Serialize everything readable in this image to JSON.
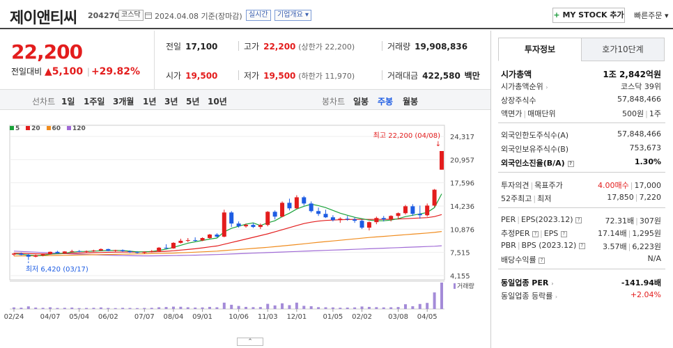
{
  "header": {
    "company": "제이앤티씨",
    "code": "204270",
    "market": "코스닥",
    "date": "2024.04.08",
    "basis": "기준(장마감)",
    "realtime": "실시간",
    "overview": "기업개요",
    "mystock": "MY STOCK 추가",
    "quick_order": "빠른주문"
  },
  "price": {
    "current": "22,200",
    "vs_label": "전일대비",
    "change": "5,100",
    "change_pct": "+29.82%"
  },
  "stats": {
    "prev_label": "전일",
    "prev": "17,100",
    "high_label": "고가",
    "high": "22,200",
    "upper_limit": "(상한가 22,200)",
    "volume_label": "거래량",
    "volume": "19,908,836",
    "open_label": "시가",
    "open": "19,500",
    "low_label": "저가",
    "low": "19,500",
    "lower_limit": "(하한가 11,970)",
    "amount_label": "거래대금",
    "amount": "422,580",
    "amount_unit": "백만"
  },
  "periods": {
    "line_label": "선차트",
    "line": [
      "1일",
      "1주일",
      "3개월",
      "1년",
      "3년",
      "5년",
      "10년"
    ],
    "candle_label": "봉차트",
    "candle": [
      "일봉",
      "주봉",
      "월봉"
    ]
  },
  "legend": [
    "5",
    "20",
    "60",
    "120"
  ],
  "colors": {
    "ma5": "#1aa23a",
    "ma20": "#e31d1d",
    "ma60": "#f08c1e",
    "ma120": "#a06bd6",
    "up": "#e31d1d",
    "down": "#1d5ce3",
    "volume": "#a48bd8"
  },
  "annotations": {
    "high": "최고 22,200 (04/08)",
    "low": "최저 6,420 (03/17)",
    "volume_label": "거래량"
  },
  "chart_data": {
    "type": "candlestick",
    "y_ticks": [
      "24,317",
      "20,957",
      "17,596",
      "14,236",
      "10,876",
      "7,515",
      "4,155"
    ],
    "x_ticks": [
      "02/24",
      "04/07",
      "05/04",
      "06/02",
      "07/07",
      "08/04",
      "09/01",
      "10/06",
      "11/03",
      "12/01",
      "01/05",
      "02/02",
      "03/08",
      "04/05"
    ],
    "ylim": [
      4155,
      24317
    ],
    "candles": [
      [
        7200,
        7450,
        7000,
        7350
      ],
      [
        7350,
        7500,
        7100,
        7150
      ],
      [
        7150,
        7300,
        6420,
        6900
      ],
      [
        6900,
        7200,
        6800,
        7100
      ],
      [
        7100,
        7350,
        6950,
        7250
      ],
      [
        7250,
        7650,
        7200,
        7600
      ],
      [
        7600,
        7750,
        7350,
        7400
      ],
      [
        7400,
        7700,
        7300,
        7650
      ],
      [
        7650,
        7900,
        7500,
        7700
      ],
      [
        7700,
        7850,
        7550,
        7600
      ],
      [
        7600,
        7800,
        7450,
        7700
      ],
      [
        7700,
        7900,
        7600,
        7800
      ],
      [
        7800,
        8100,
        7700,
        8000
      ],
      [
        8000,
        8050,
        7700,
        7750
      ],
      [
        7750,
        7900,
        7600,
        7850
      ],
      [
        7850,
        7950,
        7600,
        7700
      ],
      [
        7700,
        7800,
        7450,
        7550
      ],
      [
        7550,
        7700,
        7350,
        7450
      ],
      [
        7450,
        7650,
        7300,
        7600
      ],
      [
        7600,
        7850,
        7500,
        7700
      ],
      [
        7700,
        8300,
        7600,
        8200
      ],
      [
        8200,
        8700,
        8000,
        8100
      ],
      [
        8100,
        9000,
        8050,
        8900
      ],
      [
        8900,
        9500,
        8800,
        9200
      ],
      [
        9200,
        9600,
        9000,
        9300
      ],
      [
        9300,
        9700,
        9100,
        9250
      ],
      [
        9250,
        9700,
        9150,
        9600
      ],
      [
        9600,
        10200,
        9500,
        10100
      ],
      [
        10100,
        10300,
        9700,
        9800
      ],
      [
        9800,
        13700,
        9700,
        13300
      ],
      [
        13300,
        13500,
        11200,
        11700
      ],
      [
        11700,
        12000,
        11100,
        11300
      ],
      [
        11300,
        11700,
        11100,
        11500
      ],
      [
        11500,
        11800,
        11050,
        11200
      ],
      [
        11200,
        11700,
        10900,
        11500
      ],
      [
        11500,
        13500,
        11300,
        13400
      ],
      [
        13400,
        13600,
        12300,
        12700
      ],
      [
        12700,
        14900,
        12600,
        14700
      ],
      [
        14700,
        15300,
        13600,
        13900
      ],
      [
        13900,
        15800,
        13800,
        15500
      ],
      [
        15500,
        15700,
        14300,
        14600
      ],
      [
        14600,
        14900,
        13300,
        13500
      ],
      [
        13500,
        14000,
        12800,
        13100
      ],
      [
        13100,
        13700,
        12500,
        12600
      ],
      [
        12600,
        12900,
        12000,
        12200
      ],
      [
        12200,
        12600,
        11800,
        12400
      ],
      [
        12400,
        12800,
        12100,
        12300
      ],
      [
        12300,
        12600,
        11800,
        12100
      ],
      [
        12100,
        12300,
        10900,
        11100
      ],
      [
        11100,
        12000,
        10700,
        11900
      ],
      [
        11900,
        12700,
        11600,
        12500
      ],
      [
        12500,
        12800,
        12000,
        12300
      ],
      [
        12300,
        12900,
        12000,
        12800
      ],
      [
        12800,
        13300,
        12300,
        13200
      ],
      [
        13200,
        14400,
        13000,
        14200
      ],
      [
        14200,
        14500,
        12800,
        13100
      ],
      [
        13100,
        14300,
        12400,
        12900
      ],
      [
        12900,
        14600,
        12700,
        14300
      ],
      [
        14300,
        16700,
        14100,
        16600
      ],
      [
        19500,
        22200,
        19500,
        22200
      ]
    ],
    "ma5": [
      7300,
      7250,
      7150,
      7050,
      7100,
      7250,
      7350,
      7400,
      7550,
      7650,
      7650,
      7700,
      7750,
      7780,
      7800,
      7780,
      7700,
      7600,
      7600,
      7650,
      7800,
      8000,
      8250,
      8550,
      8850,
      9050,
      9250,
      9450,
      9600,
      10500,
      11000,
      11300,
      11600,
      11800,
      11400,
      11800,
      12100,
      12700,
      13200,
      13800,
      14200,
      14500,
      14300,
      14000,
      13600,
      13200,
      12900,
      12600,
      12400,
      12200,
      12100,
      12100,
      12200,
      12400,
      12700,
      12900,
      13100,
      13300,
      14000,
      16000
    ],
    "ma20": [
      7400,
      7380,
      7350,
      7320,
      7300,
      7300,
      7320,
      7350,
      7400,
      7430,
      7450,
      7480,
      7500,
      7530,
      7550,
      7560,
      7570,
      7570,
      7580,
      7590,
      7620,
      7680,
      7750,
      7850,
      7950,
      8050,
      8180,
      8320,
      8450,
      8700,
      8950,
      9200,
      9450,
      9700,
      9950,
      10200,
      10500,
      10800,
      11100,
      11400,
      11700,
      11900,
      12050,
      12150,
      12200,
      12250,
      12280,
      12300,
      12300,
      12300,
      12300,
      12300,
      12320,
      12350,
      12400,
      12450,
      12500,
      12550,
      12700,
      13000
    ],
    "ma60": [
      7000,
      7010,
      7020,
      7030,
      7040,
      7060,
      7080,
      7100,
      7120,
      7140,
      7160,
      7180,
      7200,
      7220,
      7240,
      7260,
      7280,
      7300,
      7320,
      7340,
      7360,
      7390,
      7420,
      7460,
      7500,
      7550,
      7600,
      7650,
      7700,
      7780,
      7860,
      7940,
      8020,
      8100,
      8180,
      8260,
      8350,
      8450,
      8550,
      8650,
      8760,
      8870,
      8980,
      9080,
      9180,
      9280,
      9380,
      9480,
      9580,
      9680,
      9760,
      9840,
      9920,
      10000,
      10080,
      10160,
      10240,
      10320,
      10420,
      10550
    ],
    "ma120": [
      7700,
      7650,
      7600,
      7550,
      7500,
      7450,
      7400,
      7350,
      7300,
      7260,
      7220,
      7180,
      7140,
      7110,
      7080,
      7060,
      7040,
      7030,
      7020,
      7020,
      7030,
      7040,
      7060,
      7080,
      7100,
      7120,
      7150,
      7180,
      7210,
      7250,
      7290,
      7330,
      7370,
      7410,
      7450,
      7490,
      7530,
      7570,
      7610,
      7650,
      7690,
      7730,
      7770,
      7810,
      7850,
      7890,
      7930,
      7970,
      8010,
      8050,
      8090,
      8130,
      8170,
      8210,
      8250,
      8290,
      8330,
      8370,
      8410,
      8480
    ],
    "volume": [
      1.2,
      1.0,
      2.0,
      1.1,
      0.9,
      1.3,
      0.8,
      0.9,
      1.1,
      0.7,
      0.8,
      0.9,
      1.2,
      0.8,
      0.7,
      0.9,
      0.8,
      0.7,
      0.8,
      0.9,
      1.3,
      1.5,
      1.8,
      1.7,
      1.3,
      1.1,
      1.2,
      1.6,
      1.3,
      4.8,
      3.2,
      2.3,
      1.6,
      1.4,
      1.5,
      3.9,
      2.7,
      4.3,
      2.9,
      4.8,
      2.4,
      2.1,
      1.4,
      1.3,
      1.2,
      1.0,
      1.1,
      1.2,
      1.9,
      1.6,
      1.4,
      1.2,
      1.3,
      1.5,
      3.6,
      2.1,
      3.8,
      4.6,
      12.5,
      19.9
    ]
  },
  "right": {
    "tabs": [
      "투자정보",
      "호가10단계"
    ],
    "market_cap_label": "시가총액",
    "market_cap": "1조 2,842억원",
    "rank_label": "시가총액순위",
    "rank": "코스닥 39위",
    "shares_label": "상장주식수",
    "shares": "57,848,466",
    "par_label": "액면가",
    "unit_label": "매매단위",
    "par": "500원",
    "unit": "1주",
    "foreign_limit_label": "외국인한도주식수(A)",
    "foreign_limit": "57,848,466",
    "foreign_hold_label": "외국인보유주식수(B)",
    "foreign_hold": "753,673",
    "foreign_ratio_label": "외국인소진율(B/A)",
    "foreign_ratio": "1.30%",
    "opinion_label": "투자의견",
    "target_label": "목표주가",
    "opinion": "4.00매수",
    "target": "17,000",
    "w52_label": "52주최고",
    "w52_low_label": "최저",
    "w52_high": "17,850",
    "w52_low": "7,220",
    "per_label": "PER",
    "eps_label": "EPS(2023.12)",
    "per": "72.31배",
    "eps": "307원",
    "eper_label": "추정PER",
    "eeps_label": "EPS",
    "eper": "17.14배",
    "eeps": "1,295원",
    "pbr_label": "PBR",
    "bps_label": "BPS (2023.12)",
    "pbr": "3.57배",
    "bps": "6,223원",
    "div_label": "배당수익률",
    "div": "N/A",
    "sector_per_label": "동일업종 PER",
    "sector_per": "-141.94배",
    "sector_chg_label": "동일업종 등락률",
    "sector_chg": "+2.04%"
  }
}
